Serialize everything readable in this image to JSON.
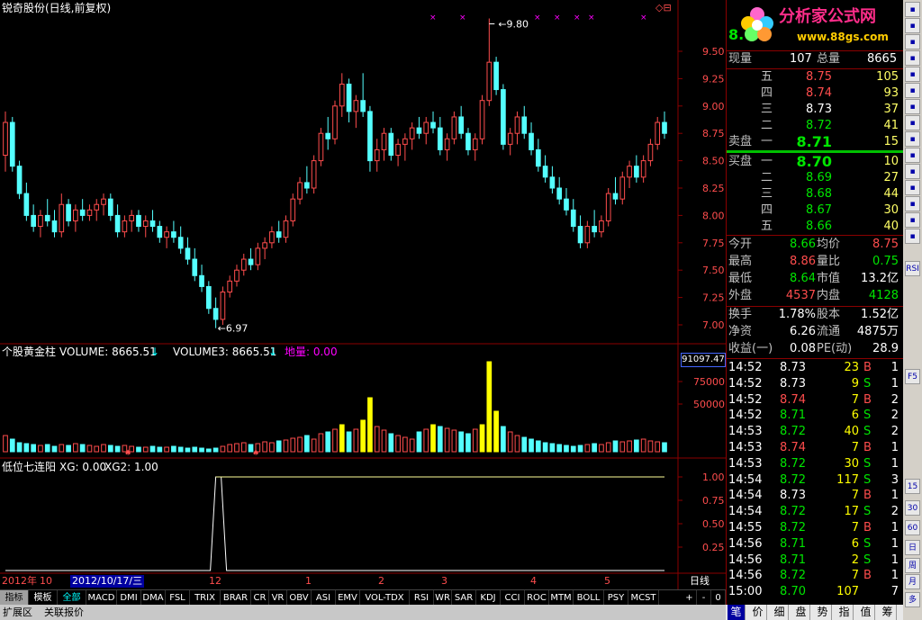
{
  "window": {
    "title": "锐奇股份(日线,前复权)"
  },
  "price_chart": {
    "high_label": "9.80",
    "low_label": "6.97",
    "y_ticks": [
      "9.50",
      "9.25",
      "9.00",
      "8.75",
      "8.50",
      "8.25",
      "8.00",
      "7.75",
      "7.50",
      "7.25",
      "7.00"
    ]
  },
  "volume_panel": {
    "name": "个股黄金柱",
    "vol1": "VOLUME: 8665.51",
    "vol2": "VOLUME3: 8665.51",
    "diliang": "地量: 0.00",
    "box_value": "91097.47",
    "y_ticks": [
      "75000",
      "50000"
    ]
  },
  "signal_panel": {
    "name": "低位七连阳",
    "xg": "XG: 0.00",
    "xg2": "XG2: 1.00",
    "y_ticks": [
      "1.00",
      "0.75",
      "0.50",
      "0.25"
    ]
  },
  "date_axis": {
    "year_label": "2012年",
    "month_10": "10",
    "cursor_date": "2012/10/17/三",
    "months": [
      "12",
      "1",
      "2",
      "3",
      "4",
      "5"
    ],
    "period": "日线"
  },
  "indicator_tabs": [
    "指标",
    "模板",
    "全部",
    "MACD",
    "DMI",
    "DMA",
    "FSL",
    "TRIX",
    "BRAR",
    "CR",
    "VR",
    "OBV",
    "ASI",
    "EMV",
    "VOL-TDX",
    "RSI",
    "WR",
    "SAR",
    "KDJ",
    "CCI",
    "ROC",
    "MTM",
    "BOLL",
    "PSY",
    "MCST"
  ],
  "tab_controls": [
    "+",
    "-",
    "0"
  ],
  "bottom_tabs": [
    "扩展区",
    "关联报价"
  ],
  "quote": {
    "logo_text": "分析家公式网",
    "logo_url": "www.88gs.com",
    "current_price_partial": "8.",
    "now_vol_label": "现量",
    "now_vol": "107",
    "total_vol_label": "总量",
    "total_vol": "8665",
    "asks": [
      {
        "label": "五",
        "price": "8.75",
        "vol": "105",
        "color": "r"
      },
      {
        "label": "四",
        "price": "8.74",
        "vol": "93",
        "color": "r"
      },
      {
        "label": "三",
        "price": "8.73",
        "vol": "37",
        "color": "w"
      },
      {
        "label": "二",
        "price": "8.72",
        "vol": "41",
        "color": "g"
      },
      {
        "label": "一",
        "price": "8.71",
        "vol": "15",
        "color": "g"
      }
    ],
    "sell_label": "卖盘",
    "buy_label": "买盘",
    "bids": [
      {
        "label": "一",
        "price": "8.70",
        "vol": "10",
        "color": "g"
      },
      {
        "label": "二",
        "price": "8.69",
        "vol": "27",
        "color": "g"
      },
      {
        "label": "三",
        "price": "8.68",
        "vol": "44",
        "color": "g"
      },
      {
        "label": "四",
        "price": "8.67",
        "vol": "30",
        "color": "g"
      },
      {
        "label": "五",
        "price": "8.66",
        "vol": "40",
        "color": "g"
      }
    ],
    "stats": [
      {
        "l1": "今开",
        "v1": "8.66",
        "c1": "g",
        "l2": "均价",
        "v2": "8.75",
        "c2": "r"
      },
      {
        "l1": "最高",
        "v1": "8.86",
        "c1": "r",
        "l2": "量比",
        "v2": "0.75",
        "c2": "g"
      },
      {
        "l1": "最低",
        "v1": "8.64",
        "c1": "g",
        "l2": "市值",
        "v2": "13.2亿",
        "c2": "w"
      },
      {
        "l1": "外盘",
        "v1": "4537",
        "c1": "r",
        "l2": "内盘",
        "v2": "4128",
        "c2": "g"
      }
    ],
    "fin": [
      {
        "l1": "换手",
        "v1": "1.78%",
        "l2": "股本",
        "v2": "1.52亿"
      },
      {
        "l1": "净资",
        "v1": "6.26",
        "l2": "流通",
        "v2": "4875万"
      },
      {
        "l1": "收益(一)",
        "v1": "0.08",
        "l2": "PE(动)",
        "v2": "28.9"
      }
    ],
    "ticks": [
      {
        "t": "14:52",
        "p": "8.73",
        "pc": "w",
        "v": "23",
        "s": "B",
        "n": "1"
      },
      {
        "t": "14:52",
        "p": "8.73",
        "pc": "w",
        "v": "9",
        "s": "S",
        "n": "1"
      },
      {
        "t": "14:52",
        "p": "8.74",
        "pc": "r",
        "v": "7",
        "s": "B",
        "n": "2"
      },
      {
        "t": "14:52",
        "p": "8.71",
        "pc": "g",
        "v": "6",
        "s": "S",
        "n": "2"
      },
      {
        "t": "14:53",
        "p": "8.72",
        "pc": "g",
        "v": "40",
        "s": "S",
        "n": "2"
      },
      {
        "t": "14:53",
        "p": "8.74",
        "pc": "r",
        "v": "7",
        "s": "B",
        "n": "1"
      },
      {
        "t": "14:53",
        "p": "8.72",
        "pc": "g",
        "v": "30",
        "s": "S",
        "n": "1"
      },
      {
        "t": "14:54",
        "p": "8.72",
        "pc": "g",
        "v": "117",
        "s": "S",
        "n": "3"
      },
      {
        "t": "14:54",
        "p": "8.73",
        "pc": "w",
        "v": "7",
        "s": "B",
        "n": "1"
      },
      {
        "t": "14:54",
        "p": "8.72",
        "pc": "g",
        "v": "17",
        "s": "S",
        "n": "2"
      },
      {
        "t": "14:55",
        "p": "8.72",
        "pc": "g",
        "v": "7",
        "s": "B",
        "n": "1"
      },
      {
        "t": "14:56",
        "p": "8.71",
        "pc": "g",
        "v": "6",
        "s": "S",
        "n": "1"
      },
      {
        "t": "14:56",
        "p": "8.71",
        "pc": "g",
        "v": "2",
        "s": "S",
        "n": "1"
      },
      {
        "t": "14:56",
        "p": "8.72",
        "pc": "g",
        "v": "7",
        "s": "B",
        "n": "1"
      },
      {
        "t": "15:00",
        "p": "8.70",
        "pc": "g",
        "v": "107",
        "s": "",
        "n": "7"
      }
    ],
    "right_tabs": [
      "笔",
      "价",
      "细",
      "盘",
      "势",
      "指",
      "值",
      "筹"
    ]
  },
  "right_toolbar": [
    "RSI",
    "F5",
    "15",
    "30",
    "60",
    "日",
    "周",
    "月",
    "多"
  ],
  "chart_data": {
    "type": "candlestick",
    "candles": [
      [
        8.55,
        8.95,
        8.4,
        8.85
      ],
      [
        8.85,
        8.9,
        8.4,
        8.45
      ],
      [
        8.45,
        8.5,
        8.15,
        8.2
      ],
      [
        8.2,
        8.3,
        7.95,
        8.0
      ],
      [
        8.0,
        8.1,
        7.85,
        7.9
      ],
      [
        7.9,
        8.05,
        7.8,
        8.0
      ],
      [
        8.0,
        8.15,
        7.9,
        7.95
      ],
      [
        7.95,
        8.05,
        7.8,
        7.85
      ],
      [
        7.85,
        8.2,
        7.8,
        8.1
      ],
      [
        8.1,
        8.15,
        7.9,
        7.95
      ],
      [
        7.95,
        8.1,
        7.85,
        8.05
      ],
      [
        8.05,
        8.15,
        7.95,
        8.0
      ],
      [
        8.0,
        8.1,
        7.95,
        8.05
      ],
      [
        8.05,
        8.15,
        7.95,
        8.1
      ],
      [
        8.1,
        8.2,
        8.0,
        8.15
      ],
      [
        8.15,
        8.2,
        7.95,
        8.0
      ],
      [
        8.0,
        8.1,
        7.8,
        7.85
      ],
      [
        7.85,
        8.0,
        7.8,
        7.95
      ],
      [
        7.95,
        8.05,
        7.85,
        8.0
      ],
      [
        8.0,
        8.05,
        7.85,
        7.9
      ],
      [
        7.9,
        8.0,
        7.8,
        7.95
      ],
      [
        7.95,
        8.05,
        7.85,
        7.9
      ],
      [
        7.9,
        7.95,
        7.75,
        7.8
      ],
      [
        7.8,
        7.9,
        7.7,
        7.85
      ],
      [
        7.85,
        7.95,
        7.75,
        7.8
      ],
      [
        7.8,
        7.9,
        7.65,
        7.7
      ],
      [
        7.7,
        7.8,
        7.55,
        7.6
      ],
      [
        7.6,
        7.7,
        7.4,
        7.45
      ],
      [
        7.45,
        7.55,
        7.3,
        7.35
      ],
      [
        7.35,
        7.4,
        7.1,
        7.15
      ],
      [
        7.15,
        7.25,
        6.97,
        7.05
      ],
      [
        7.05,
        7.35,
        7.0,
        7.3
      ],
      [
        7.3,
        7.45,
        7.25,
        7.4
      ],
      [
        7.4,
        7.55,
        7.35,
        7.5
      ],
      [
        7.5,
        7.65,
        7.45,
        7.6
      ],
      [
        7.6,
        7.7,
        7.5,
        7.55
      ],
      [
        7.55,
        7.75,
        7.5,
        7.7
      ],
      [
        7.7,
        7.8,
        7.6,
        7.75
      ],
      [
        7.75,
        7.9,
        7.7,
        7.85
      ],
      [
        7.85,
        7.95,
        7.75,
        7.8
      ],
      [
        7.8,
        8.0,
        7.75,
        7.95
      ],
      [
        7.95,
        8.2,
        7.9,
        8.15
      ],
      [
        8.15,
        8.35,
        8.1,
        8.3
      ],
      [
        8.3,
        8.45,
        8.2,
        8.25
      ],
      [
        8.25,
        8.55,
        8.2,
        8.5
      ],
      [
        8.5,
        8.8,
        8.45,
        8.75
      ],
      [
        8.75,
        8.9,
        8.6,
        8.7
      ],
      [
        8.7,
        9.05,
        8.65,
        9.0
      ],
      [
        9.0,
        9.3,
        8.9,
        9.2
      ],
      [
        9.2,
        9.25,
        8.85,
        8.95
      ],
      [
        8.95,
        9.1,
        8.8,
        9.05
      ],
      [
        9.05,
        9.3,
        8.9,
        8.95
      ],
      [
        8.95,
        9.0,
        8.4,
        8.5
      ],
      [
        8.5,
        8.7,
        8.4,
        8.6
      ],
      [
        8.6,
        8.8,
        8.5,
        8.75
      ],
      [
        8.75,
        8.8,
        8.5,
        8.55
      ],
      [
        8.55,
        8.7,
        8.45,
        8.65
      ],
      [
        8.65,
        8.75,
        8.5,
        8.7
      ],
      [
        8.7,
        8.85,
        8.6,
        8.8
      ],
      [
        8.8,
        8.9,
        8.7,
        8.75
      ],
      [
        8.75,
        8.9,
        8.65,
        8.85
      ],
      [
        8.85,
        8.95,
        8.75,
        8.8
      ],
      [
        8.8,
        8.9,
        8.55,
        8.6
      ],
      [
        8.6,
        8.75,
        8.5,
        8.7
      ],
      [
        8.7,
        8.95,
        8.65,
        8.9
      ],
      [
        8.9,
        9.0,
        8.7,
        8.75
      ],
      [
        8.75,
        8.8,
        8.55,
        8.6
      ],
      [
        8.6,
        8.75,
        8.5,
        8.7
      ],
      [
        8.7,
        9.1,
        8.65,
        9.05
      ],
      [
        9.05,
        9.8,
        9.0,
        9.4
      ],
      [
        9.4,
        9.45,
        9.1,
        9.15
      ],
      [
        9.15,
        9.2,
        8.6,
        8.65
      ],
      [
        8.65,
        8.8,
        8.55,
        8.75
      ],
      [
        8.75,
        8.95,
        8.65,
        8.9
      ],
      [
        8.9,
        9.0,
        8.7,
        8.75
      ],
      [
        8.75,
        8.85,
        8.55,
        8.6
      ],
      [
        8.6,
        8.7,
        8.4,
        8.45
      ],
      [
        8.45,
        8.55,
        8.3,
        8.35
      ],
      [
        8.35,
        8.45,
        8.2,
        8.25
      ],
      [
        8.25,
        8.35,
        8.1,
        8.15
      ],
      [
        8.15,
        8.25,
        8.0,
        8.05
      ],
      [
        8.05,
        8.15,
        7.85,
        7.9
      ],
      [
        7.9,
        8.0,
        7.7,
        7.75
      ],
      [
        7.75,
        7.95,
        7.7,
        7.9
      ],
      [
        7.9,
        8.05,
        7.8,
        7.85
      ],
      [
        7.85,
        8.0,
        7.8,
        7.95
      ],
      [
        7.95,
        8.25,
        7.9,
        8.2
      ],
      [
        8.2,
        8.35,
        8.1,
        8.15
      ],
      [
        8.15,
        8.4,
        8.1,
        8.35
      ],
      [
        8.35,
        8.5,
        8.25,
        8.45
      ],
      [
        8.45,
        8.55,
        8.3,
        8.35
      ],
      [
        8.35,
        8.55,
        8.3,
        8.5
      ],
      [
        8.5,
        8.7,
        8.45,
        8.65
      ],
      [
        8.65,
        8.9,
        8.6,
        8.85
      ],
      [
        8.85,
        8.95,
        8.7,
        8.75
      ]
    ],
    "volume": [
      18,
      14,
      10,
      9,
      8,
      7,
      8,
      6,
      8,
      7,
      9,
      8,
      7,
      6,
      8,
      7,
      6,
      7,
      6,
      5,
      5,
      6,
      5,
      5,
      6,
      5,
      4,
      5,
      4,
      3,
      4,
      6,
      8,
      9,
      10,
      8,
      9,
      11,
      10,
      12,
      13,
      15,
      16,
      18,
      14,
      20,
      22,
      25,
      30,
      22,
      25,
      35,
      60,
      28,
      24,
      20,
      18,
      16,
      14,
      22,
      25,
      30,
      28,
      26,
      24,
      22,
      20,
      25,
      30,
      100,
      45,
      28,
      22,
      18,
      16,
      14,
      12,
      10,
      9,
      8,
      7,
      6,
      7,
      8,
      9,
      8,
      10,
      12,
      11,
      12,
      13,
      14,
      12,
      11,
      10
    ],
    "signal": {
      "start_index": 30,
      "value_after": 1.0
    }
  }
}
